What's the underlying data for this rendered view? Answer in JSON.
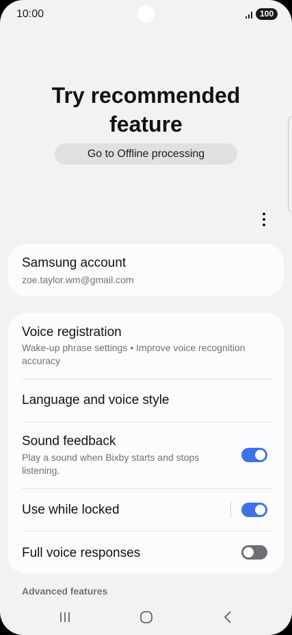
{
  "status": {
    "time": "10:00",
    "battery": "100",
    "signal_icon": "signal-icon"
  },
  "promo": {
    "title": "Try recommended feature",
    "button_label": "Go to Offline processing"
  },
  "menu": {
    "more_icon": "more-options-icon"
  },
  "account": {
    "title": "Samsung account",
    "email": "zoe.taylor.wm@gmail.com"
  },
  "settings": {
    "voice_registration": {
      "title": "Voice registration",
      "subtitle": "Wake-up phrase settings • Improve voice recognition accuracy"
    },
    "language": {
      "title": "Language and voice style"
    },
    "sound_feedback": {
      "title": "Sound feedback",
      "subtitle": "Play a sound when Bixby starts and stops listening.",
      "enabled": true
    },
    "use_while_locked": {
      "title": "Use while locked",
      "enabled": true
    },
    "full_voice_responses": {
      "title": "Full voice responses",
      "enabled": false
    }
  },
  "advanced": {
    "label": "Advanced features"
  },
  "nav": {
    "recents_icon": "recents-icon",
    "home_icon": "home-icon",
    "back_icon": "back-icon"
  },
  "colors": {
    "accent": "#3e71e8",
    "background": "#f2f2f4",
    "card": "#fcfcfe"
  }
}
